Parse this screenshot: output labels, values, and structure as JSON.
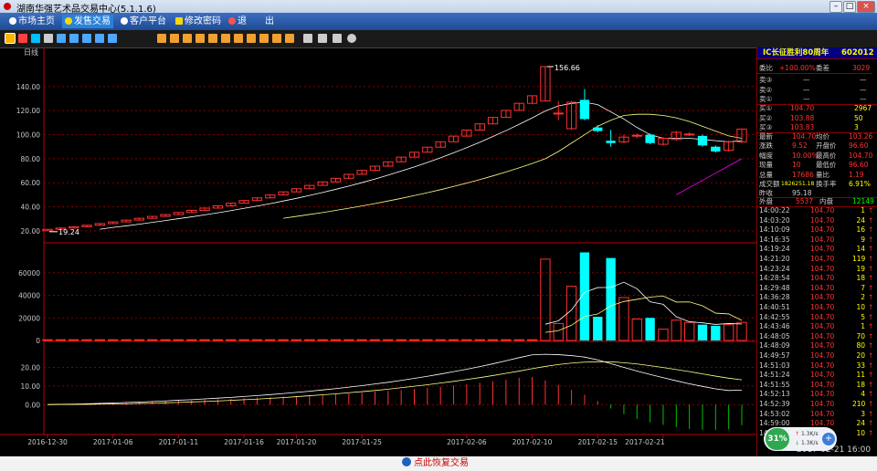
{
  "window": {
    "title": "湖南华强艺术品交易中心(5.1.1.6)",
    "min": "–",
    "max": "□",
    "close": "×"
  },
  "menu": [
    {
      "label": "市场主页",
      "icon": "globe-icon"
    },
    {
      "label": "发售交易",
      "icon": "yen-icon"
    },
    {
      "label": "客户平台",
      "icon": "globe-icon"
    },
    {
      "label": "修改密码",
      "icon": "key-icon"
    },
    {
      "label": "退　　出",
      "icon": "exit-icon"
    }
  ],
  "toolbar": {
    "icons": [
      "bar-chart-icon",
      "line-chart-icon",
      "candles-icon",
      "calendar-icon",
      "list-icon",
      "grid-icon",
      "grid-icon",
      "grid-icon",
      "excel-icon",
      "square-icon",
      "square-icon",
      "square-icon",
      "square-icon",
      "square-icon",
      "square-icon",
      "square-icon",
      "square-icon",
      "square-icon",
      "square-icon",
      "square-icon",
      "zoom-in-icon",
      "zoom-out-icon",
      "draw-icon",
      "settings-icon"
    ]
  },
  "chart": {
    "period_label": "日线",
    "max_label": "156.66",
    "min_label": "19.24",
    "price_ticks": [
      "140.00",
      "120.00",
      "100.00",
      "80.00",
      "60.00",
      "40.00",
      "20.00"
    ],
    "vol_ticks": [
      "60000",
      "40000",
      "20000",
      "0"
    ],
    "ind_ticks": [
      "20.00",
      "10.00",
      "0.00"
    ],
    "dates": [
      "2016-12-30",
      "2017-01-06",
      "2017-01-11",
      "2017-01-16",
      "2017-01-20",
      "2017-01-25",
      "2017-02-06",
      "2017-02-10",
      "2017-02-15",
      "2017-02-21"
    ],
    "colors": {
      "up": "#ff3232",
      "down": "#00ffff",
      "ma1": "#ffffff",
      "ma2": "#ffff80",
      "ma3": "#ff00ff",
      "ma4": "#00ff00",
      "axis": "#c00000"
    }
  },
  "chart_data": {
    "type": "candlestick",
    "title": "",
    "ylim": [
      10,
      165
    ],
    "candles": [
      {
        "o": 20.0,
        "c": 21.2,
        "h": 21.2,
        "l": 20.0
      },
      {
        "o": 21.2,
        "c": 22.3,
        "h": 22.3,
        "l": 21.2
      },
      {
        "o": 22.3,
        "c": 23.4,
        "h": 23.4,
        "l": 22.3
      },
      {
        "o": 23.4,
        "c": 24.6,
        "h": 24.6,
        "l": 23.4
      },
      {
        "o": 24.6,
        "c": 26.0,
        "h": 26.0,
        "l": 24.6
      },
      {
        "o": 26.0,
        "c": 27.4,
        "h": 27.4,
        "l": 26.0
      },
      {
        "o": 27.4,
        "c": 28.9,
        "h": 28.9,
        "l": 27.4
      },
      {
        "o": 28.9,
        "c": 30.4,
        "h": 30.4,
        "l": 28.9
      },
      {
        "o": 30.4,
        "c": 32.0,
        "h": 32.0,
        "l": 30.4
      },
      {
        "o": 32.0,
        "c": 33.5,
        "h": 33.5,
        "l": 32.0
      },
      {
        "o": 33.5,
        "c": 35.2,
        "h": 35.2,
        "l": 33.5
      },
      {
        "o": 35.2,
        "c": 37.0,
        "h": 37.0,
        "l": 35.2
      },
      {
        "o": 37.0,
        "c": 38.9,
        "h": 38.9,
        "l": 37.0
      },
      {
        "o": 38.9,
        "c": 40.8,
        "h": 40.8,
        "l": 38.9
      },
      {
        "o": 40.8,
        "c": 43.0,
        "h": 43.0,
        "l": 40.8
      },
      {
        "o": 43.0,
        "c": 45.2,
        "h": 45.2,
        "l": 43.0
      },
      {
        "o": 45.2,
        "c": 47.4,
        "h": 47.4,
        "l": 45.2
      },
      {
        "o": 47.4,
        "c": 49.8,
        "h": 49.8,
        "l": 47.4
      },
      {
        "o": 49.8,
        "c": 52.4,
        "h": 52.4,
        "l": 49.8
      },
      {
        "o": 52.4,
        "c": 55.0,
        "h": 55.0,
        "l": 52.4
      },
      {
        "o": 55.0,
        "c": 57.8,
        "h": 57.8,
        "l": 55.0
      },
      {
        "o": 57.8,
        "c": 60.7,
        "h": 60.7,
        "l": 57.8
      },
      {
        "o": 60.7,
        "c": 63.7,
        "h": 63.7,
        "l": 60.7
      },
      {
        "o": 63.7,
        "c": 67.0,
        "h": 67.0,
        "l": 63.7
      },
      {
        "o": 67.0,
        "c": 70.3,
        "h": 70.3,
        "l": 67.0
      },
      {
        "o": 70.3,
        "c": 73.8,
        "h": 73.8,
        "l": 70.3
      },
      {
        "o": 73.8,
        "c": 77.4,
        "h": 77.4,
        "l": 73.8
      },
      {
        "o": 77.4,
        "c": 81.3,
        "h": 81.3,
        "l": 77.4
      },
      {
        "o": 81.3,
        "c": 85.4,
        "h": 85.4,
        "l": 81.3
      },
      {
        "o": 85.4,
        "c": 89.6,
        "h": 89.6,
        "l": 85.4
      },
      {
        "o": 89.6,
        "c": 94.1,
        "h": 94.1,
        "l": 89.6
      },
      {
        "o": 94.1,
        "c": 98.8,
        "h": 98.8,
        "l": 94.1
      },
      {
        "o": 98.8,
        "c": 103.8,
        "h": 103.8,
        "l": 98.8
      },
      {
        "o": 103.8,
        "c": 109.0,
        "h": 109.0,
        "l": 103.8
      },
      {
        "o": 109.0,
        "c": 114.4,
        "h": 114.4,
        "l": 109.0
      },
      {
        "o": 114.4,
        "c": 120.2,
        "h": 120.2,
        "l": 114.4
      },
      {
        "o": 120.2,
        "c": 126.1,
        "h": 126.1,
        "l": 120.2
      },
      {
        "o": 126.1,
        "c": 132.4,
        "h": 132.4,
        "l": 126.1
      },
      {
        "o": 128.0,
        "c": 156.66,
        "h": 156.66,
        "l": 128.0
      },
      {
        "o": 118.0,
        "c": 118.0,
        "h": 128.0,
        "l": 112.0
      },
      {
        "o": 105.0,
        "c": 127.0,
        "h": 128.0,
        "l": 104.0
      },
      {
        "o": 129.0,
        "c": 113.0,
        "h": 138.0,
        "l": 112.0
      },
      {
        "o": 106.0,
        "c": 103.0,
        "h": 108.0,
        "l": 102.0
      },
      {
        "o": 95.0,
        "c": 93.0,
        "h": 104.0,
        "l": 90.0
      },
      {
        "o": 94.0,
        "c": 98.0,
        "h": 100.0,
        "l": 93.0
      },
      {
        "o": 99.0,
        "c": 99.5,
        "h": 101.0,
        "l": 97.0
      },
      {
        "o": 100.0,
        "c": 93.0,
        "h": 101.0,
        "l": 92.0
      },
      {
        "o": 92.0,
        "c": 97.0,
        "h": 98.0,
        "l": 91.0
      },
      {
        "o": 96.0,
        "c": 102.0,
        "h": 103.0,
        "l": 95.0
      },
      {
        "o": 100.0,
        "c": 100.5,
        "h": 102.0,
        "l": 99.0
      },
      {
        "o": 99.0,
        "c": 91.0,
        "h": 100.0,
        "l": 90.0
      },
      {
        "o": 90.0,
        "c": 86.0,
        "h": 91.0,
        "l": 85.0
      },
      {
        "o": 87.0,
        "c": 94.0,
        "h": 95.0,
        "l": 86.0
      },
      {
        "o": 94.0,
        "c": 104.7,
        "h": 104.7,
        "l": 93.0
      }
    ],
    "volume": [
      0,
      0,
      0,
      0,
      0,
      0,
      0,
      0,
      0,
      0,
      0,
      0,
      0,
      0,
      0,
      0,
      0,
      0,
      0,
      0,
      0,
      0,
      0,
      0,
      0,
      0,
      0,
      0,
      0,
      0,
      0,
      0,
      0,
      0,
      0,
      0,
      0,
      0,
      72000,
      15000,
      48000,
      78000,
      21000,
      73000,
      38000,
      19000,
      20000,
      10000,
      18000,
      16000,
      14000,
      13000,
      14000,
      16000
    ],
    "volume_ylim": [
      0,
      80000
    ],
    "ma1": [
      null,
      null,
      null,
      null,
      21.3,
      22.8,
      24.1,
      25.5,
      27.0,
      28.5,
      30.1,
      31.6,
      33.3,
      35.0,
      36.8,
      38.7,
      40.6,
      42.6,
      44.8,
      47.0,
      49.4,
      51.9,
      54.5,
      57.2,
      60.1,
      63.1,
      66.3,
      69.7,
      73.2,
      76.9,
      80.8,
      84.9,
      89.2,
      93.7,
      98.5,
      103.4,
      108.6,
      114.0,
      119.7,
      124.0,
      126.0,
      127.0,
      125.0,
      119.0,
      113.0,
      106.0,
      100.0,
      97.0,
      97.0,
      97.0,
      96.0,
      95.0,
      94.0,
      95.0
    ],
    "ma2": [
      null,
      null,
      null,
      null,
      null,
      null,
      null,
      null,
      null,
      null,
      null,
      null,
      null,
      null,
      null,
      null,
      null,
      null,
      30.4,
      32.0,
      33.6,
      35.2,
      37.0,
      38.8,
      40.7,
      42.7,
      44.8,
      47.0,
      49.3,
      51.7,
      54.2,
      56.9,
      59.7,
      62.6,
      65.7,
      69.0,
      72.4,
      76.0,
      80.0,
      86.0,
      93.0,
      100.0,
      107.0,
      112.0,
      116.0,
      117.0,
      117.0,
      116.0,
      114.0,
      111.0,
      107.0,
      103.0,
      99.0,
      97.0
    ],
    "ma3": [
      null,
      null,
      null,
      null,
      null,
      null,
      null,
      null,
      null,
      null,
      null,
      null,
      null,
      null,
      null,
      null,
      null,
      null,
      null,
      null,
      null,
      null,
      null,
      null,
      null,
      null,
      null,
      null,
      null,
      null,
      null,
      null,
      null,
      null,
      null,
      null,
      null,
      null,
      null,
      null,
      null,
      null,
      null,
      null,
      null,
      null,
      null,
      null,
      50.0,
      56.0,
      62.0,
      68.0,
      74.0,
      80.0
    ],
    "indicator": {
      "ylim": [
        0,
        30
      ],
      "dif": [
        0.1,
        0.2,
        0.3,
        0.5,
        0.7,
        0.9,
        1.2,
        1.4,
        1.7,
        2.0,
        2.4,
        2.7,
        3.1,
        3.5,
        3.9,
        4.4,
        4.9,
        5.4,
        6.0,
        6.6,
        7.2,
        7.9,
        8.6,
        9.4,
        10.2,
        11.1,
        12.0,
        13.0,
        14.1,
        15.2,
        16.4,
        17.7,
        19.0,
        20.4,
        21.9,
        23.5,
        25.2,
        26.7,
        27.0,
        26.8,
        26.3,
        25.5,
        24.0,
        22.0,
        20.0,
        18.0,
        16.2,
        14.5,
        12.8,
        11.2,
        9.8,
        8.5,
        7.6,
        7.8
      ],
      "dea": [
        0.0,
        0.1,
        0.1,
        0.2,
        0.3,
        0.4,
        0.5,
        0.7,
        0.8,
        1.0,
        1.2,
        1.5,
        1.7,
        2.0,
        2.3,
        2.7,
        3.0,
        3.4,
        3.8,
        4.3,
        4.8,
        5.3,
        5.8,
        6.4,
        7.0,
        7.6,
        8.3,
        9.1,
        9.9,
        10.7,
        11.6,
        12.5,
        13.5,
        14.5,
        15.6,
        16.8,
        18.0,
        19.3,
        20.5,
        21.5,
        22.3,
        22.8,
        23.0,
        23.0,
        22.5,
        21.8,
        20.9,
        19.9,
        18.8,
        17.7,
        16.5,
        15.3,
        14.2,
        13.3
      ],
      "macd": [
        0.2,
        0.2,
        0.4,
        0.6,
        0.8,
        1.0,
        1.4,
        1.4,
        1.8,
        2.0,
        2.4,
        2.4,
        2.8,
        3.0,
        3.2,
        3.4,
        3.8,
        4.0,
        4.4,
        4.6,
        4.8,
        5.2,
        5.6,
        6.0,
        6.4,
        7.0,
        7.4,
        7.8,
        8.4,
        9.0,
        9.6,
        10.4,
        11.0,
        11.8,
        12.6,
        13.4,
        14.4,
        14.8,
        13.0,
        10.6,
        8.0,
        5.4,
        2.0,
        -2.0,
        -5.0,
        -7.6,
        -9.4,
        -10.8,
        -12.0,
        -13.0,
        -13.4,
        -13.6,
        -13.2,
        -11.0
      ]
    }
  },
  "quote": {
    "name": "IC长征胜利80周年",
    "code": "602012",
    "weibi_label": "委比",
    "weibi": "+100.00%",
    "weicha_label": "委差",
    "weicha": "3029",
    "asks": [
      {
        "label": "卖③",
        "price": "—",
        "vol": "—"
      },
      {
        "label": "卖②",
        "price": "—",
        "vol": "—"
      },
      {
        "label": "卖①",
        "price": "—",
        "vol": "—"
      }
    ],
    "bids": [
      {
        "label": "买①",
        "price": "104.70",
        "vol": "2967"
      },
      {
        "label": "买②",
        "price": "103.88",
        "vol": "50"
      },
      {
        "label": "买③",
        "price": "103.83",
        "vol": "3"
      }
    ],
    "stats": [
      {
        "l1": "最新",
        "v1": "104.70",
        "l2": "均价",
        "v2": "103.26"
      },
      {
        "l1": "涨跌",
        "v1": "9.52",
        "l2": "开盘价",
        "v2": "96.60"
      },
      {
        "l1": "幅度",
        "v1": "10.00%",
        "l2": "最高价",
        "v2": "104.70"
      },
      {
        "l1": "现量",
        "v1": "10",
        "l2": "最低价",
        "v2": "96.60"
      },
      {
        "l1": "总量",
        "v1": "17686",
        "l2": "量比",
        "v2": "1.19"
      },
      {
        "l1": "成交额",
        "v1": "1826251.18",
        "l2": "换手率",
        "v2": "6.91%"
      },
      {
        "l1": "昨收",
        "v1": "95.18",
        "l2": "",
        "v2": ""
      }
    ],
    "waipan_label": "外盘",
    "waipan": "5537",
    "neipan_label": "内盘",
    "neipan": "12149",
    "ticks": [
      {
        "t": "14:00:22",
        "p": "104.70",
        "v": "1"
      },
      {
        "t": "14:03:20",
        "p": "104.70",
        "v": "24"
      },
      {
        "t": "14:10:09",
        "p": "104.70",
        "v": "16"
      },
      {
        "t": "14:16:35",
        "p": "104.70",
        "v": "9"
      },
      {
        "t": "14:19:24",
        "p": "104.70",
        "v": "14"
      },
      {
        "t": "14:21:20",
        "p": "104.70",
        "v": "119"
      },
      {
        "t": "14:23:24",
        "p": "104.70",
        "v": "19"
      },
      {
        "t": "14:28:54",
        "p": "104.70",
        "v": "18"
      },
      {
        "t": "14:29:48",
        "p": "104.70",
        "v": "7"
      },
      {
        "t": "14:36:28",
        "p": "104.70",
        "v": "2"
      },
      {
        "t": "14:40:51",
        "p": "104.70",
        "v": "10"
      },
      {
        "t": "14:42:55",
        "p": "104.70",
        "v": "5"
      },
      {
        "t": "14:43:46",
        "p": "104.70",
        "v": "1"
      },
      {
        "t": "14:48:05",
        "p": "104.70",
        "v": "70"
      },
      {
        "t": "14:48:09",
        "p": "104.70",
        "v": "80"
      },
      {
        "t": "14:49:57",
        "p": "104.70",
        "v": "20"
      },
      {
        "t": "14:51:03",
        "p": "104.70",
        "v": "33"
      },
      {
        "t": "14:51:24",
        "p": "104.70",
        "v": "11"
      },
      {
        "t": "14:51:55",
        "p": "104.70",
        "v": "18"
      },
      {
        "t": "14:52:13",
        "p": "104.70",
        "v": "4"
      },
      {
        "t": "14:52:39",
        "p": "104.70",
        "v": "210"
      },
      {
        "t": "14:53:02",
        "p": "104.70",
        "v": "3"
      },
      {
        "t": "14:59:00",
        "p": "104.70",
        "v": "24"
      },
      {
        "t": "14:59:11",
        "p": "104.70",
        "v": "10"
      }
    ],
    "up_arrow": "↑"
  },
  "status": {
    "restore": "点此恢复交易",
    "datetime": "2017-02-21 16:00",
    "net_percent": "31%",
    "speed_up": "1.3K/s",
    "speed_down": "1.3K/s",
    "plus": "+"
  }
}
